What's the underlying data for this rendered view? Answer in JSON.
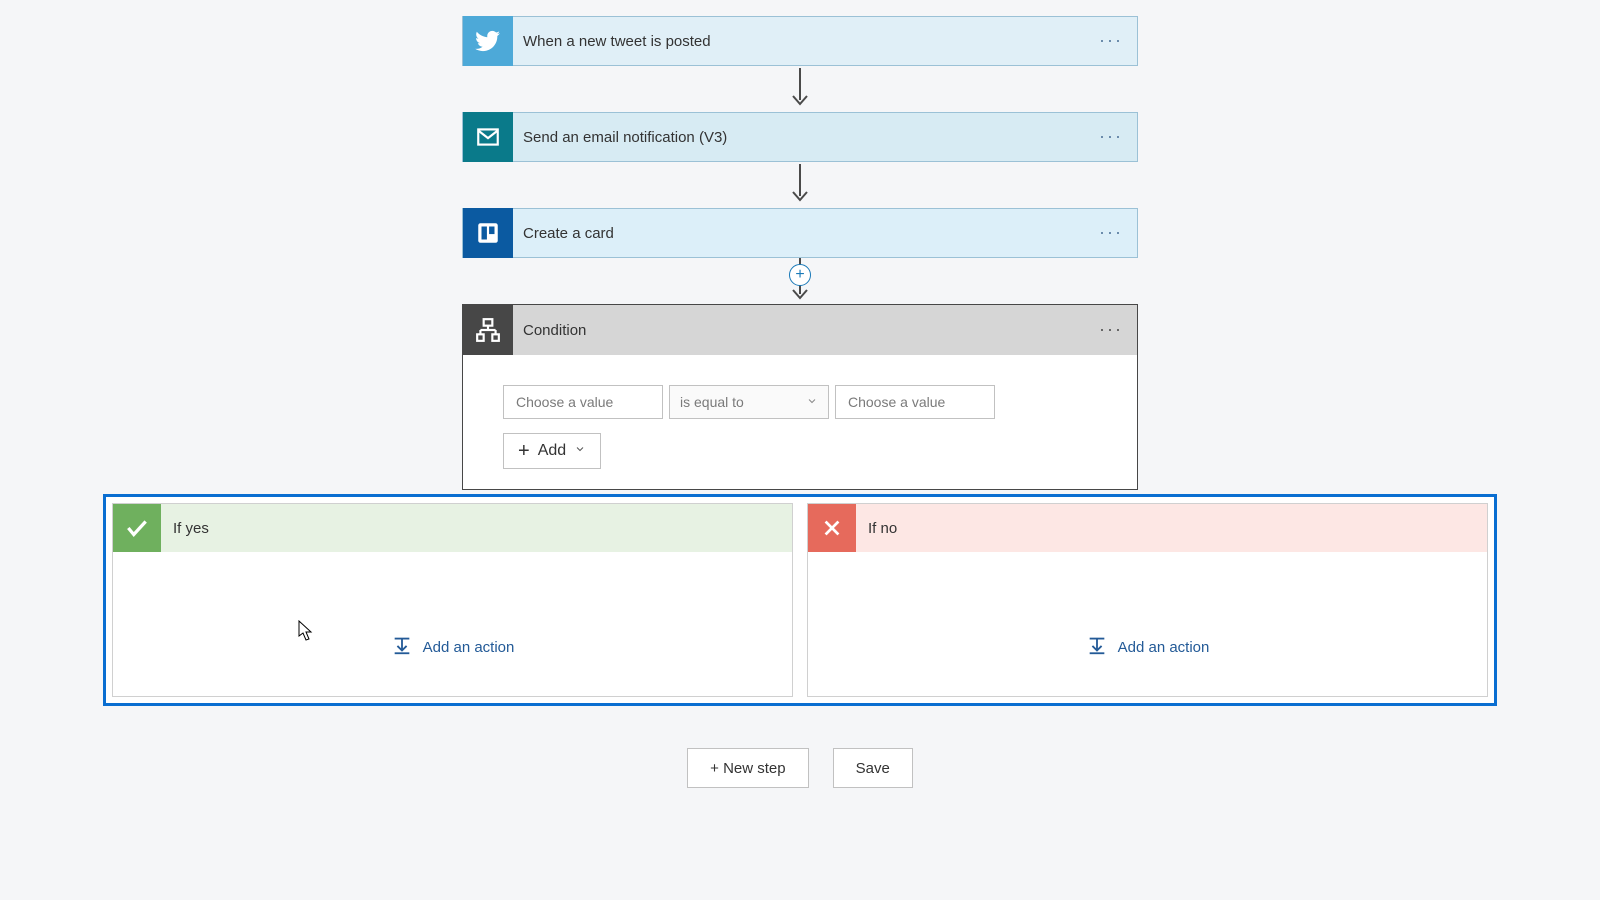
{
  "steps": {
    "twitter": {
      "label": "When a new tweet is posted"
    },
    "email": {
      "label": "Send an email notification (V3)"
    },
    "trello": {
      "label": "Create a card"
    }
  },
  "condition": {
    "title": "Condition",
    "left_placeholder": "Choose a value",
    "operator_label": "is equal to",
    "right_placeholder": "Choose a value",
    "add_label": "Add"
  },
  "branches": {
    "yes": {
      "title": "If yes",
      "add_action_label": "Add an action"
    },
    "no": {
      "title": "If no",
      "add_action_label": "Add an action"
    }
  },
  "footer": {
    "new_step_label": "+ New step",
    "save_label": "Save"
  },
  "ellipsis": "···",
  "plus_symbol": "+"
}
